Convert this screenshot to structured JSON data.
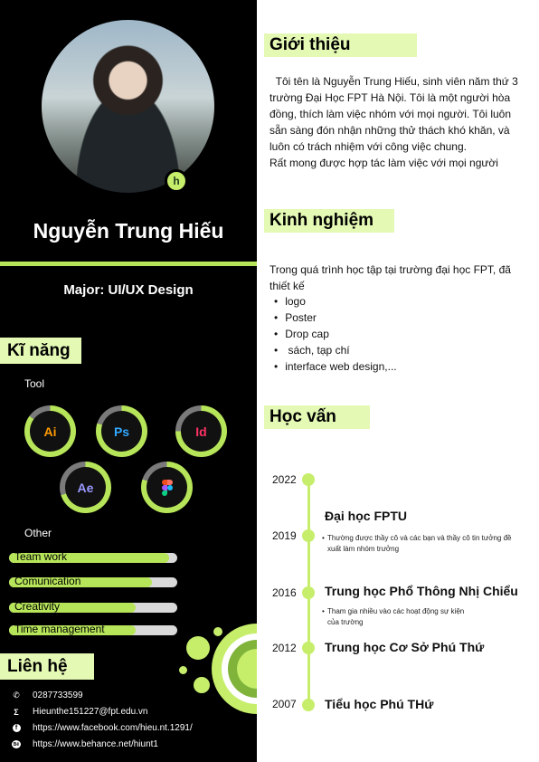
{
  "profile": {
    "name": "Nguyễn Trung Hiếu",
    "major": "Major: UI/UX Design",
    "badge": "h"
  },
  "skills": {
    "title": "Kĩ năng",
    "tool_label": "Tool",
    "tools": [
      {
        "label": "Ai",
        "color": "#ff9a00",
        "level": 0.85
      },
      {
        "label": "Ps",
        "color": "#31a8ff",
        "level": 0.8
      },
      {
        "label": "Id",
        "color": "#ff3366",
        "level": 0.75
      },
      {
        "label": "Ae",
        "color": "#9999ff",
        "level": 0.7
      },
      {
        "label": "Figma",
        "color": "#f24e1e",
        "level": 0.8
      }
    ],
    "other_label": "Other",
    "other": [
      {
        "label": "Team work",
        "level": 0.95
      },
      {
        "label": "Comunication",
        "level": 0.85
      },
      {
        "label": "Creativity",
        "level": 0.75
      },
      {
        "label": "Time management",
        "level": 0.75
      }
    ]
  },
  "contact": {
    "title": "Liên hệ",
    "phone": "0287733599",
    "email": "Hieunthe151227@fpt.edu.vn",
    "facebook": "https://www.facebook.com/hieu.nt.1291/",
    "behance": "https://www.behance.net/hiunt1",
    "icons": [
      "phone-icon",
      "email-icon",
      "facebook-icon",
      "behance-icon"
    ]
  },
  "about": {
    "title": "Giới thiệu",
    "text": "  Tôi tên là Nguyễn Trung Hiếu, sinh viên năm thứ 3 trường Đại Học FPT Hà Nội. Tôi là một người hòa đồng, thích làm việc nhóm với mọi người. Tôi luôn sẵn sàng đón nhận những thử thách khó khăn, và luôn có trách nhiệm với công việc chung.",
    "text2": "Rất mong được hợp tác làm việc với mọi người"
  },
  "experience": {
    "title": "Kinh nghiệm",
    "intro": "Trong quá trình học tập tại trường đại học FPT, đã thiết kế",
    "items": [
      "logo",
      "Poster",
      "Drop cap",
      " sách, tạp chí",
      "interface web design,..."
    ]
  },
  "education": {
    "title": "Học vấn",
    "years": [
      "2022",
      "2019",
      "2016",
      "2012",
      "2007"
    ],
    "schools": [
      {
        "name": "Đại học FPTU",
        "desc": "Thường được thầy cô và các bạn và thầy cô tin tưởng đề xuất làm nhóm trưởng"
      },
      {
        "name": "Trung học Phổ Thông Nhị Chiểu",
        "desc": "Tham gia nhiều vào các hoạt động sự kiện của trường"
      },
      {
        "name": "Trung học Cơ Sở Phú Thứ",
        "desc": ""
      },
      {
        "name": "Tiểu học Phú THứ",
        "desc": ""
      }
    ]
  },
  "colors": {
    "accent": "#b7e55a",
    "accent_light": "#e4f9b4",
    "sidebar": "#000000"
  }
}
